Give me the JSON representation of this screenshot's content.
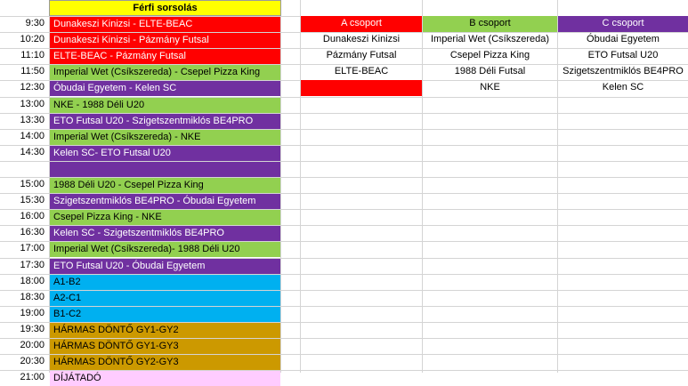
{
  "sheet": {
    "title": "Férfi sorsolás",
    "colors": {
      "red": "#ff0000",
      "green": "#92d050",
      "purple": "#7030a0",
      "blue": "#00b0f0",
      "gold": "#cc9900",
      "pink": "#ffccff",
      "yellow": "#ffff00"
    },
    "schedule": [
      {
        "time": "9:30",
        "match": "Dunakeszi Kinizsi - ELTE-BEAC",
        "color": "red"
      },
      {
        "time": "10:20",
        "match": "Dunakeszi Kinizsi - Pázmány Futsal",
        "color": "red"
      },
      {
        "time": "11:10",
        "match": "ELTE-BEAC - Pázmány Futsal",
        "color": "red"
      },
      {
        "time": "11:50",
        "match": "Imperial Wet (Csíkszereda) - Csepel Pizza King",
        "color": "green"
      },
      {
        "time": "12:30",
        "match": "Óbudai Egyetem - Kelen SC",
        "color": "purple"
      },
      {
        "time": "13:00",
        "match": "NKE - 1988 Déli U20",
        "color": "green"
      },
      {
        "time": "13:30",
        "match": "ETO Futsal U20 - Szigetszentmiklós BE4PRO",
        "color": "purple"
      },
      {
        "time": "14:00",
        "match": "Imperial Wet (Csíkszereda) - NKE",
        "color": "green"
      },
      {
        "time": "14:30",
        "match": "Kelen SC- ETO Futsal U20",
        "color": "purple"
      },
      {
        "time": "",
        "match": "",
        "color": "purple"
      },
      {
        "time": "15:00",
        "match": "1988 Déli U20 - Csepel Pizza King",
        "color": "green"
      },
      {
        "time": "15:30",
        "match": "Szigetszentmiklós BE4PRO - Óbudai Egyetem",
        "color": "purple"
      },
      {
        "time": "16:00",
        "match": "Csepel Pizza King - NKE",
        "color": "green"
      },
      {
        "time": "16:30",
        "match": "Kelen SC - Szigetszentmiklós BE4PRO",
        "color": "purple"
      },
      {
        "time": "17:00",
        "match": "Imperial Wet (Csíkszereda)- 1988 Déli U20",
        "color": "green"
      },
      {
        "time": "17:30",
        "match": "ETO Futsal U20 - Óbudai Egyetem",
        "color": "purple"
      },
      {
        "time": "18:00",
        "match": "A1-B2",
        "color": "blue"
      },
      {
        "time": "18:30",
        "match": "A2-C1",
        "color": "blue"
      },
      {
        "time": "19:00",
        "match": "B1-C2",
        "color": "blue"
      },
      {
        "time": "19:30",
        "match": "HÁRMAS DÖNTŐ GY1-GY2",
        "color": "gold"
      },
      {
        "time": "20:00",
        "match": "HÁRMAS DÖNTŐ GY1-GY3",
        "color": "gold"
      },
      {
        "time": "20:30",
        "match": "HÁRMAS DÖNTŐ GY2-GY3",
        "color": "gold"
      },
      {
        "time": "21:00",
        "match": "DÍJÁTADÓ",
        "color": "pink"
      }
    ],
    "groups": [
      {
        "name": "A csoport",
        "color": "red",
        "teams": [
          "Dunakeszi Kinizsi",
          "Pázmány Futsal",
          "ELTE-BEAC",
          ""
        ]
      },
      {
        "name": "B csoport",
        "color": "green",
        "teams": [
          "Imperial Wet (Csíkszereda)",
          "Csepel Pizza King",
          "1988 Déli Futsal",
          "NKE"
        ]
      },
      {
        "name": "C csoport",
        "color": "purple",
        "teams": [
          "Óbudai Egyetem",
          "ETO Futsal U20",
          "Szigetszentmiklós BE4PRO",
          "Kelen SC"
        ]
      }
    ]
  }
}
